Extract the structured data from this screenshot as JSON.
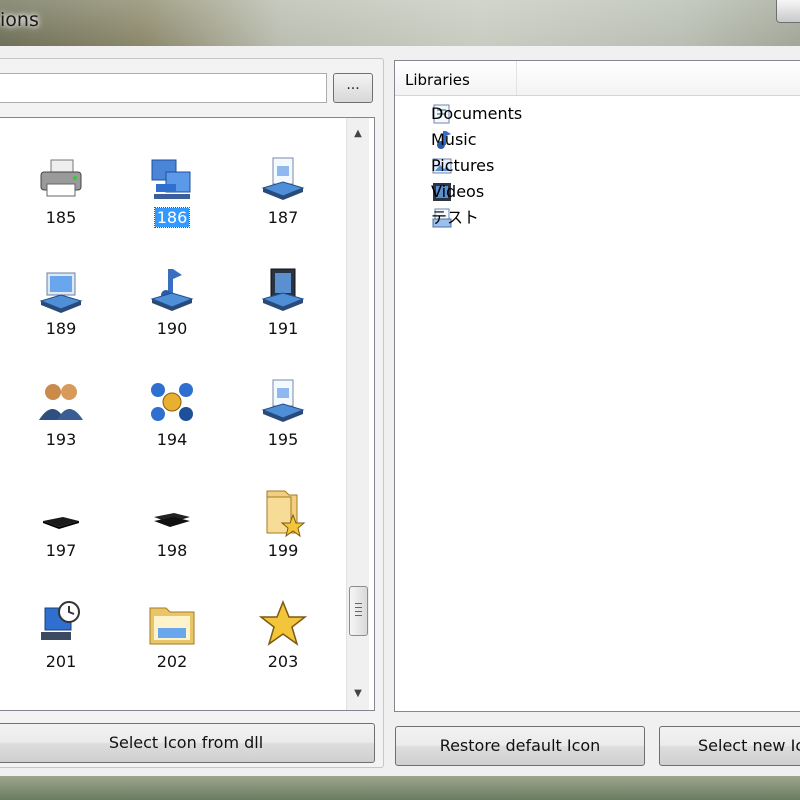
{
  "window": {
    "title": "ions"
  },
  "path_input": {
    "value": "",
    "placeholder": ""
  },
  "browse_button": {
    "label": "..."
  },
  "icons": [
    {
      "num": "185",
      "icon": "printer-icon",
      "selected": false
    },
    {
      "num": "186",
      "icon": "network-computers-icon",
      "selected": true
    },
    {
      "num": "187",
      "icon": "document-drive-icon",
      "selected": false
    },
    {
      "num": "189",
      "icon": "laptop-icon",
      "selected": false
    },
    {
      "num": "190",
      "icon": "music-drive-icon",
      "selected": false
    },
    {
      "num": "191",
      "icon": "video-drive-icon",
      "selected": false
    },
    {
      "num": "193",
      "icon": "users-icon",
      "selected": false
    },
    {
      "num": "194",
      "icon": "globe-network-icon",
      "selected": false
    },
    {
      "num": "195",
      "icon": "document-drive-icon",
      "selected": false
    },
    {
      "num": "197",
      "icon": "flat-drive-icon",
      "selected": false
    },
    {
      "num": "198",
      "icon": "flat-drive-dark-icon",
      "selected": false
    },
    {
      "num": "199",
      "icon": "folder-star-icon",
      "selected": false
    },
    {
      "num": "201",
      "icon": "computer-clock-icon",
      "selected": false
    },
    {
      "num": "202",
      "icon": "folder-open-icon",
      "selected": false
    },
    {
      "num": "203",
      "icon": "star-icon",
      "selected": false
    }
  ],
  "select_dll_button": {
    "label": "Select Icon from dll"
  },
  "libraries": {
    "header": "Libraries",
    "items": [
      {
        "label": "Documents",
        "icon": "documents-library-icon"
      },
      {
        "label": "Music",
        "icon": "music-library-icon"
      },
      {
        "label": "Pictures",
        "icon": "pictures-library-icon"
      },
      {
        "label": "Videos",
        "icon": "videos-library-icon"
      },
      {
        "label": "テスト",
        "icon": "generic-library-icon"
      }
    ]
  },
  "restore_button": {
    "label": "Restore default Icon"
  },
  "select_new_button": {
    "label": "Select new Icon"
  },
  "colors": {
    "selection": "#3399ff",
    "accent": "#2f6fd0"
  }
}
